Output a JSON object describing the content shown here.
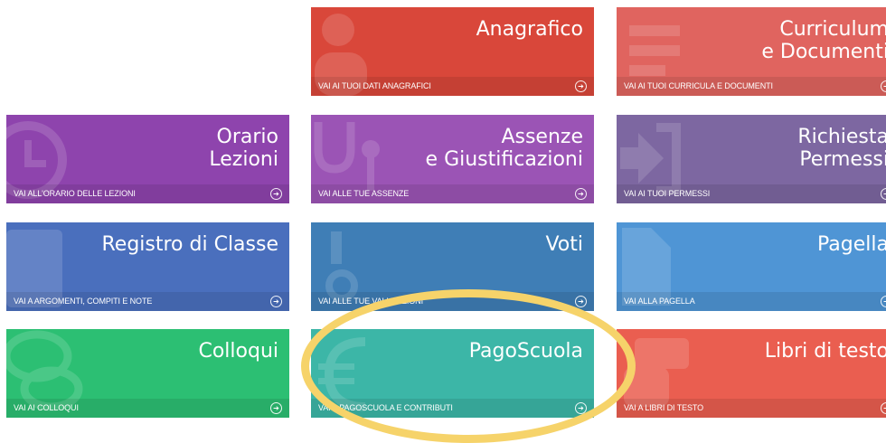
{
  "colors": {
    "anagrafico": "#d9473a",
    "curriculum": "#e0645f",
    "orario": "#8e44ad",
    "assenze": "#9b54b5",
    "permessi": "#7d67a1",
    "registro": "#4a6fbd",
    "voti": "#3f7eb6",
    "pagella": "#4f95d5",
    "colloqui": "#2cbf73",
    "pagoscuola": "#3cb6a7",
    "libri": "#ea5e50",
    "highlight": "#f6d36a"
  },
  "tiles": {
    "anagrafico": {
      "title": "Anagrafico",
      "footer": "VAI AI TUOI DATI ANAGRAFICI",
      "icon": "user-icon"
    },
    "curriculum": {
      "title": "Curriculum\ne Documenti",
      "footer": "VAI AI TUOI CURRICULA E DOCUMENTI",
      "icon": "document-lines-icon"
    },
    "orario": {
      "title": "Orario\nLezioni",
      "footer": "VAI ALL'ORARIO DELLE LEZIONI",
      "icon": "clock-icon"
    },
    "assenze": {
      "title": "Assenze\ne Giustificazioni",
      "footer": "VAI ALLE TUE ASSENZE",
      "icon": "stethoscope-icon"
    },
    "permessi": {
      "title": "Richiesta\nPermessi",
      "footer": "VAI AI TUOI PERMESSI",
      "icon": "sign-in-icon"
    },
    "registro": {
      "title": "Registro di Classe",
      "footer": "VAI A ARGOMENTI, COMPITI E NOTE",
      "icon": "notebook-icon"
    },
    "voti": {
      "title": "Voti",
      "footer": "VAI ALLE TUE VALUTAZIONI",
      "icon": "grades-icon"
    },
    "pagella": {
      "title": "Pagella",
      "footer": "VAI ALLA PAGELLA",
      "icon": "report-card-icon"
    },
    "colloqui": {
      "title": "Colloqui",
      "footer": "VAI AI COLLOQUI",
      "icon": "chat-bubbles-icon"
    },
    "pagoscuola": {
      "title": "PagoScuola",
      "footer": "VAI A PAGOSCUOLA E CONTRIBUTI",
      "icon": "euro-icon"
    },
    "libri": {
      "title": "Libri di testo",
      "footer": "VAI A LIBRI DI TESTO",
      "icon": "book-hand-icon"
    }
  },
  "arrow_glyph": "➔"
}
